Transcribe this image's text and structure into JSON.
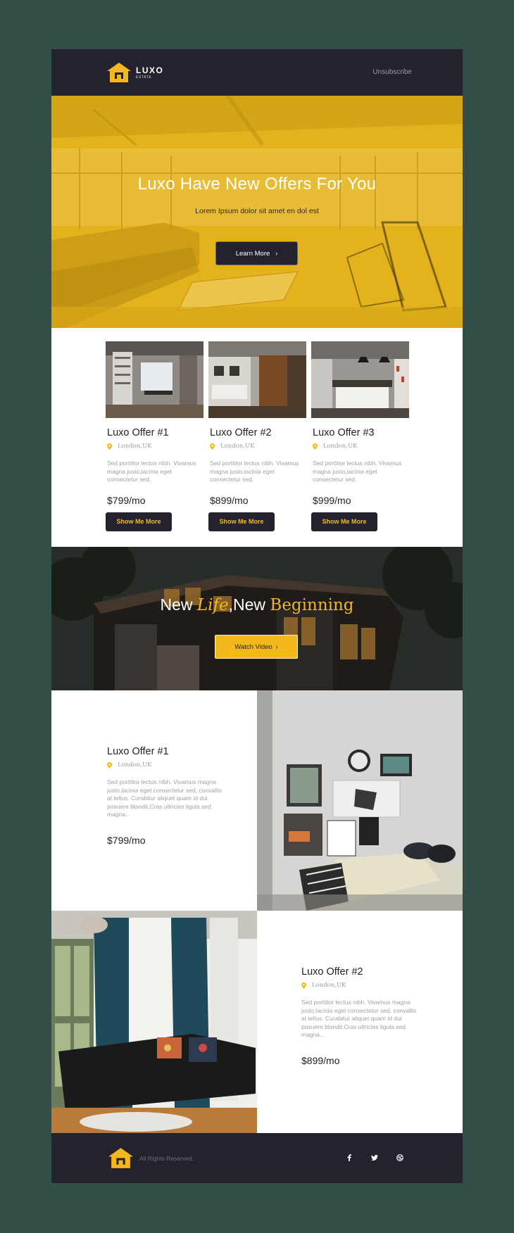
{
  "brand": {
    "name": "LUXO",
    "tagline": "ESTATE"
  },
  "header": {
    "unsubscribe": "Unsubscribe"
  },
  "hero": {
    "title": "Luxo Have New Offers For You",
    "subtitle": "Lorem Ipsum dolor sit amet en dol est",
    "button": "Learn More"
  },
  "offers": [
    {
      "title": "Luxo Offer #1",
      "location": "London,UK",
      "description": "Sed porttitor lectus nibh. Vivamus magna justo,lacinia eget consectetur sed.",
      "price": "$799/mo",
      "button": "Show Me More"
    },
    {
      "title": "Luxo Offer #2",
      "location": "London,UK",
      "description": "Sed porttitor lectus nibh. Vivamus magna justo,lacinia eget consectetur sed.",
      "price": "$899/mo",
      "button": "Show Me More"
    },
    {
      "title": "Luxo Offer #3",
      "location": "London,UK",
      "description": "Sed porttitor lectus nibh. Vivamus magna justo,lacinia eget consectetur sed.",
      "price": "$999/mo",
      "button": "Show Me More"
    }
  ],
  "banner": {
    "word1": "New ",
    "word2": "Life",
    "word3": ",New ",
    "word4": "Beginning",
    "button": "Watch Video"
  },
  "features": [
    {
      "title": "Luxo Offer #1",
      "location": "London,UK",
      "description": "Sed porttitor lectus nibh. Vivamus magna justo,lacinia eget consectetur sed, convallis at tellus. Curabitur aliquet quam id dui posuere blandit.Cras ultricies ligula sed magna...",
      "price": "$799/mo"
    },
    {
      "title": "Luxo Offer #2",
      "location": "London,UK",
      "description": "Sed porttitor lectus nibh. Vivamus magna justo,lacinia eget consectetur sed, convallis at tellus. Curabitur aliquet quam id dui posuere blandit.Cras ultricies ligula sed magna...",
      "price": "$899/mo"
    }
  ],
  "footer": {
    "rights": "All Rights Reserved.",
    "social": [
      "facebook-icon",
      "twitter-icon",
      "dribbble-icon"
    ]
  },
  "colors": {
    "accent": "#f2b81c",
    "dark": "#24232d",
    "page_bg": "#334d47"
  }
}
